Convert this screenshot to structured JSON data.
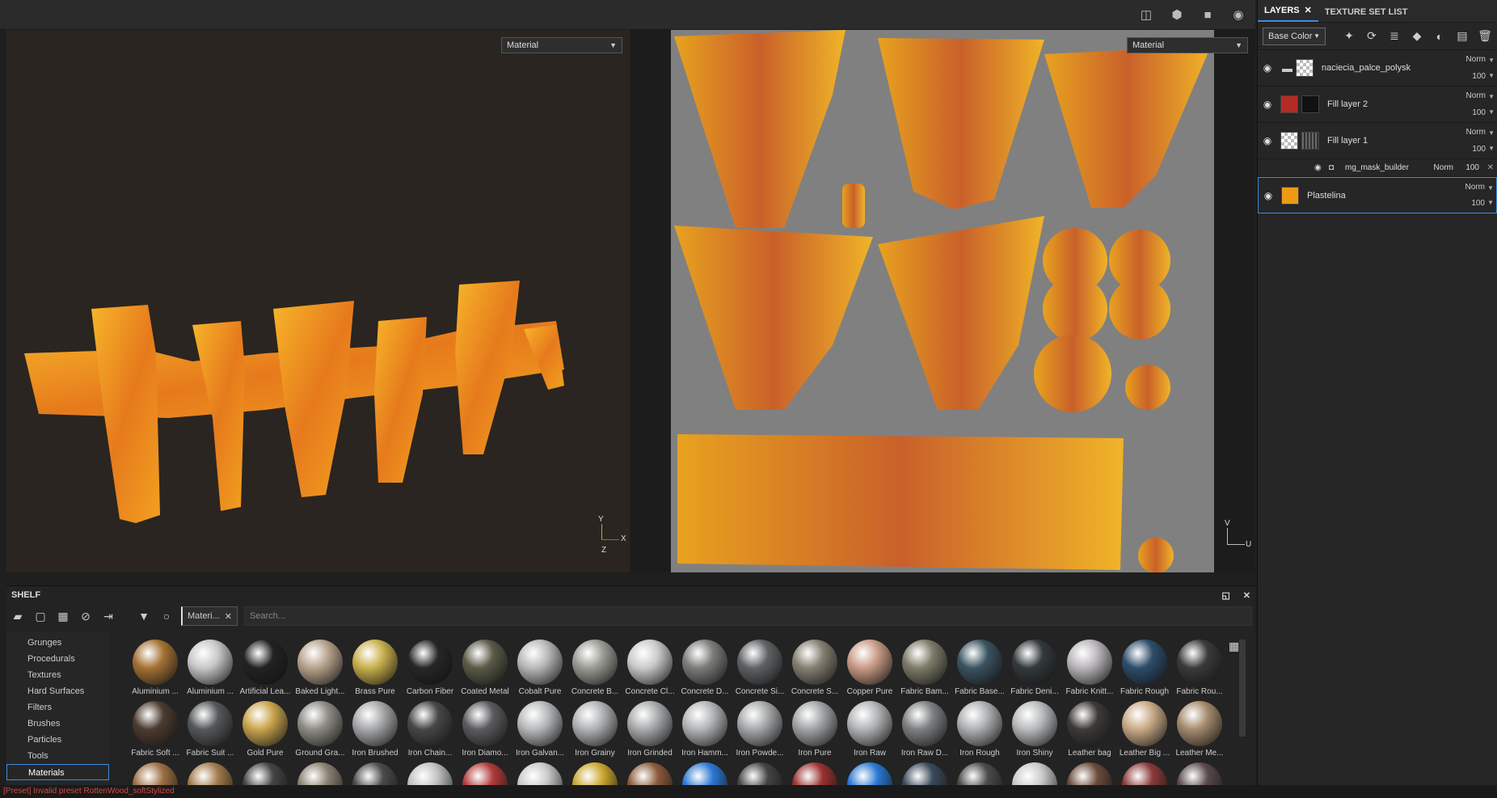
{
  "topbar": {
    "icons": [
      "split-view-icon",
      "cube-icon",
      "camera-icon",
      "screenshot-icon"
    ]
  },
  "viewport3d": {
    "mode_select": "Material",
    "axes": {
      "y": "Y",
      "x": "X",
      "z": "Z"
    }
  },
  "viewport2d": {
    "mode_select": "Material",
    "axes": {
      "v": "V",
      "u": "U"
    }
  },
  "right_panel": {
    "tabs": [
      {
        "label": "LAYERS",
        "active": true,
        "close": "✕"
      },
      {
        "label": "TEXTURE SET LIST",
        "active": false
      }
    ],
    "channel_select": "Base Color",
    "layers": [
      {
        "name": "naciecia_palce_polysk",
        "blend": "Norm",
        "opacity": "100",
        "thumb": "checker",
        "folder": true
      },
      {
        "name": "Fill layer 2",
        "blend": "Norm",
        "opacity": "100",
        "thumb": "#b52b23"
      },
      {
        "name": "Fill layer 1",
        "blend": "Norm",
        "opacity": "100",
        "thumb": "checker"
      },
      {
        "name": "Plastelina",
        "blend": "Norm",
        "opacity": "100",
        "thumb": "#f09a14",
        "selected": true
      }
    ],
    "sublayer": {
      "name": "mg_mask_builder",
      "blend": "Norm",
      "opacity": "100",
      "close": "✕"
    }
  },
  "shelf": {
    "title": "SHELF",
    "filter_chip": "Materi...",
    "search_placeholder": "Search...",
    "categories": [
      "Grunges",
      "Procedurals",
      "Textures",
      "Hard Surfaces",
      "Filters",
      "Brushes",
      "Particles",
      "Tools",
      "Materials"
    ],
    "active_category": "Materials",
    "materials_row1": [
      {
        "label": "Aluminium ...",
        "color": "#a57234"
      },
      {
        "label": "Aluminium ...",
        "color": "#c8c8c8"
      },
      {
        "label": "Artificial Lea...",
        "color": "#222222"
      },
      {
        "label": "Baked Light...",
        "color": "#b7a38c"
      },
      {
        "label": "Brass Pure",
        "color": "#c8b04c"
      },
      {
        "label": "Carbon Fiber",
        "color": "#262626"
      },
      {
        "label": "Coated Metal",
        "color": "#5a5a48"
      },
      {
        "label": "Cobalt Pure",
        "color": "#b9b9b9"
      },
      {
        "label": "Concrete B...",
        "color": "#9b9b95"
      },
      {
        "label": "Concrete Cl...",
        "color": "#c9cbc9"
      },
      {
        "label": "Concrete D...",
        "color": "#7c7c7a"
      },
      {
        "label": "Concrete Si...",
        "color": "#5f6264"
      },
      {
        "label": "Concrete S...",
        "color": "#857f72"
      },
      {
        "label": "Copper Pure",
        "color": "#c99a86"
      },
      {
        "label": "Fabric Bam...",
        "color": "#7d7b68"
      },
      {
        "label": "Fabric Base...",
        "color": "#3a5360"
      },
      {
        "label": "Fabric Deni...",
        "color": "#33393c"
      },
      {
        "label": "Fabric Knitt...",
        "color": "#b9b6ba"
      },
      {
        "label": "Fabric Rough",
        "color": "#2d4d6a"
      },
      {
        "label": "Fabric Rou...",
        "color": "#3a3a3a"
      }
    ],
    "materials_row2": [
      {
        "label": "Fabric Soft ...",
        "color": "#4c3b30"
      },
      {
        "label": "Fabric Suit ...",
        "color": "#55585a"
      },
      {
        "label": "Gold Pure",
        "color": "#c9a44c"
      },
      {
        "label": "Ground Gra...",
        "color": "#8e8c84"
      },
      {
        "label": "Iron Brushed",
        "color": "#a7a8aa"
      },
      {
        "label": "Iron Chain...",
        "color": "#474747"
      },
      {
        "label": "Iron Diamo...",
        "color": "#5a5b5d"
      },
      {
        "label": "Iron Galvan...",
        "color": "#b7b9bb"
      },
      {
        "label": "Iron Grainy",
        "color": "#b0b2b4"
      },
      {
        "label": "Iron Grinded",
        "color": "#a8aaac"
      },
      {
        "label": "Iron Hamm...",
        "color": "#b3b5b7"
      },
      {
        "label": "Iron Powde...",
        "color": "#a6a8aa"
      },
      {
        "label": "Iron Pure",
        "color": "#a1a3a5"
      },
      {
        "label": "Iron Raw",
        "color": "#b2b4b6"
      },
      {
        "label": "Iron Raw D...",
        "color": "#7d7f81"
      },
      {
        "label": "Iron Rough",
        "color": "#aeb0b2"
      },
      {
        "label": "Iron Shiny",
        "color": "#b8babc"
      },
      {
        "label": "Leather bag",
        "color": "#3d3a37"
      },
      {
        "label": "Leather Big ...",
        "color": "#c9aa86"
      },
      {
        "label": "Leather Me...",
        "color": "#a58a6c"
      }
    ],
    "materials_row3": [
      {
        "color": "#9a6e42"
      },
      {
        "color": "#a07a4a"
      },
      {
        "color": "#444444"
      },
      {
        "color": "#8a8070"
      },
      {
        "color": "#4a4a4a"
      },
      {
        "color": "#c0c0c0"
      },
      {
        "color": "#b03a3a"
      },
      {
        "color": "#c8c8c8"
      },
      {
        "color": "#c9a62c"
      },
      {
        "color": "#8a5a3a"
      },
      {
        "color": "#2a78d2"
      },
      {
        "color": "#444444"
      },
      {
        "color": "#9a3030"
      },
      {
        "color": "#2a78d2"
      },
      {
        "color": "#3a4a5a"
      },
      {
        "color": "#4a4a4a"
      },
      {
        "color": "#c8c8c8"
      },
      {
        "color": "#6a4a3a"
      },
      {
        "color": "#8a3a3a"
      },
      {
        "color": "#5a4a4a"
      }
    ]
  },
  "status": {
    "message": "[Preset] Invalid preset RottenWood_softStylized"
  }
}
